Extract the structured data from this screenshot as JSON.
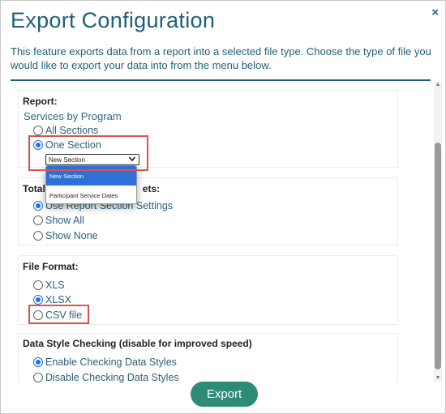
{
  "dialog": {
    "title": "Export Configuration",
    "close_glyph": "×",
    "description": "This feature exports data from a report into a selected file type. Choose the type of file you would like to export your data into from the menu below.",
    "export_label": "Export"
  },
  "report": {
    "label": "Report:",
    "program": "Services by Program",
    "options": [
      "All Sections",
      "One Section"
    ],
    "selected_option": "One Section",
    "section_select": {
      "value": "New Section",
      "options": [
        "New Section",
        "Participant Service Dates"
      ],
      "highlighted": "New Section"
    }
  },
  "totals": {
    "label": "Total",
    "label_tail": "ets:",
    "options": [
      "Use Report Section Settings",
      "Show All",
      "Show None"
    ],
    "selected_option": "Use Report Section Settings"
  },
  "file_format": {
    "label": "File Format:",
    "options": [
      "XLS",
      "XLSX",
      "CSV file"
    ],
    "selected_option": "XLSX"
  },
  "data_style": {
    "label": "Data Style Checking (disable for improved speed)",
    "options": [
      "Enable Checking Data Styles",
      "Disable Checking Data Styles"
    ],
    "selected_option": "Enable Checking Data Styles"
  },
  "colors": {
    "accent": "#1f5f7a",
    "button": "#2e8b76",
    "highlight_box": "#d9534f",
    "radio_selected": "#1a73e8",
    "dropdown_active": "#2f6fd8"
  }
}
